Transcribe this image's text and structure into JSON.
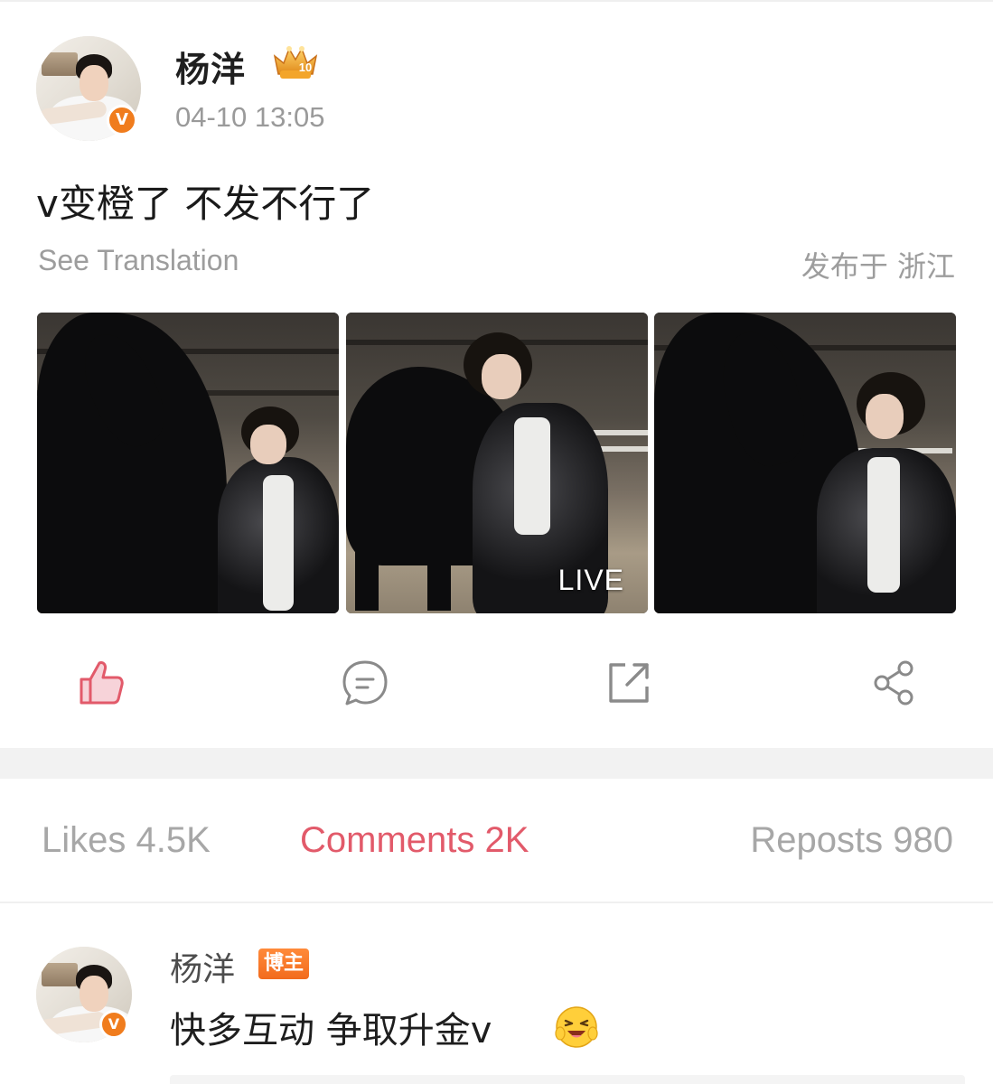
{
  "post": {
    "username": "杨洋",
    "time": "04-10 13:05",
    "text": "v变橙了 不发不行了",
    "translate_label": "See Translation",
    "location": "发布于 浙江",
    "level_badge": "10",
    "verified_mark": "V",
    "photos": [
      {
        "alt": "man with black horse in stable"
      },
      {
        "alt": "man with saddled black horse",
        "tag": "LIVE"
      },
      {
        "alt": "man beside black horse"
      }
    ]
  },
  "actions": {
    "like_icon": "thumbs-up-icon",
    "comment_icon": "comment-icon",
    "repost_icon": "repost-icon",
    "share_icon": "share-icon",
    "like_color": "#e25a6a"
  },
  "tabs": [
    {
      "label": "Likes 4.5K",
      "active": false
    },
    {
      "label": "Comments 2K",
      "active": true
    },
    {
      "label": "Reposts 980",
      "active": false
    }
  ],
  "comment": {
    "username": "杨洋",
    "author_tag": "博主",
    "text": "快多互动 争取升金v",
    "emoji": "laughing-emoji"
  },
  "colors": {
    "accent": "#e25a6a",
    "verified": "#f07c1d",
    "muted": "#9d9d9d"
  }
}
